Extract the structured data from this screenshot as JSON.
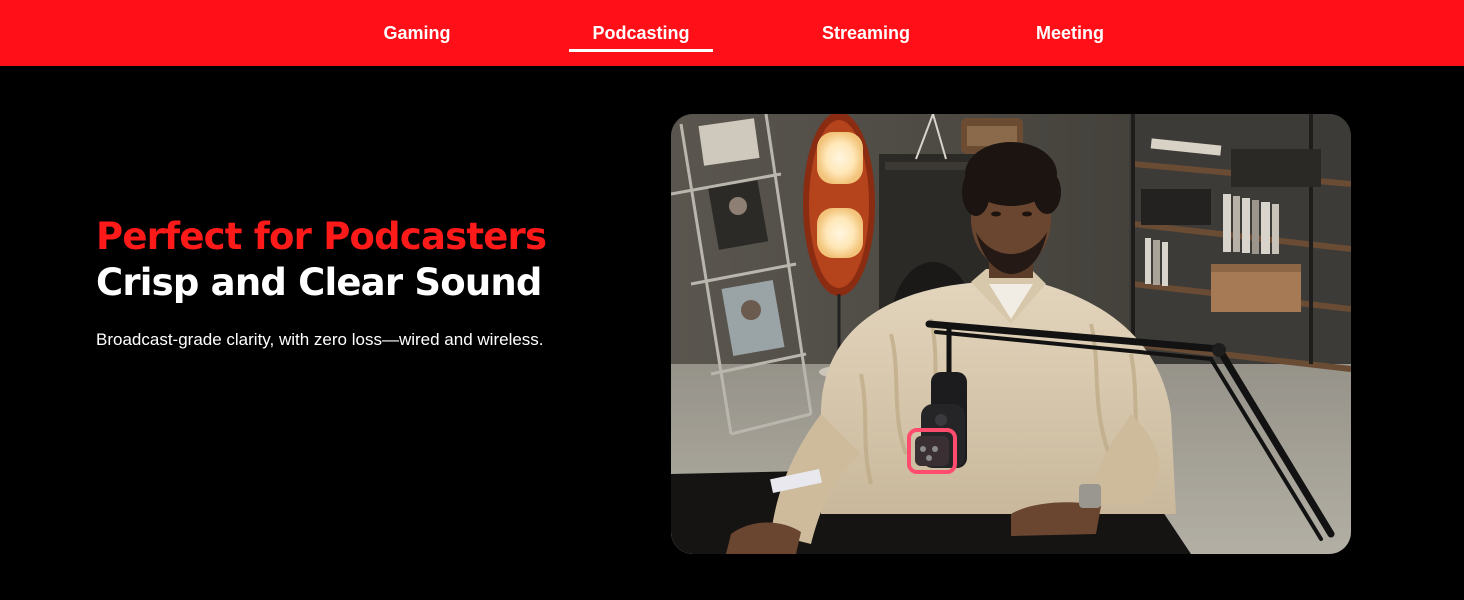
{
  "nav": {
    "tabs": [
      {
        "label": "Gaming",
        "active": false
      },
      {
        "label": "Podcasting",
        "active": true
      },
      {
        "label": "Streaming",
        "active": false
      },
      {
        "label": "Meeting",
        "active": false
      }
    ]
  },
  "hero": {
    "headline_red": "Perfect for Podcasters",
    "headline_white": "Crisp and Clear Sound",
    "subtext": "Broadcast-grade clarity, with zero loss—wired and wireless."
  },
  "colors": {
    "nav_background": "#ff0f17",
    "accent_red": "#ff1a1a",
    "page_background": "#000000",
    "text": "#ffffff"
  }
}
